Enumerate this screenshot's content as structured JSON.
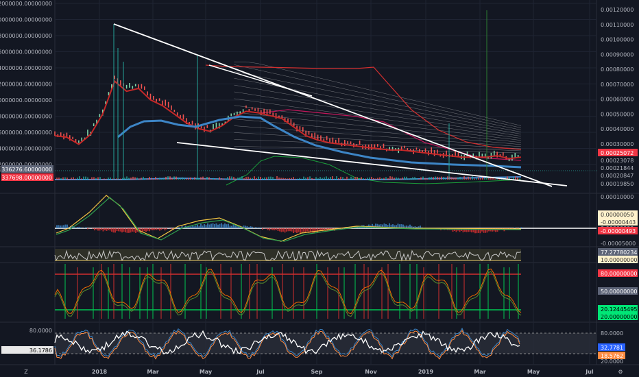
{
  "colors": {
    "background": "#131722",
    "grid": "#1f2433",
    "price_up": "#26a69a",
    "price_down": "#ef5350",
    "trend_line": "#ffffff",
    "red_band": "#c2185b",
    "blue_ma": "#3d85c6",
    "green": "#00c853",
    "label_red": "#f23645",
    "label_grey": "#5d6477",
    "label_yellow": "#fff2cc",
    "label_green": "#00e676",
    "label_blue": "#2962ff",
    "label_orange": "#ff8c42"
  },
  "chart_data": [
    {
      "type": "line",
      "panel": "price",
      "left_axis": {
        "ticks": [
          "22000000.00000000",
          "20000000.00000000",
          "18000000.00000000",
          "16000000.00000000",
          "14000000.00000000",
          "12000000.00000000",
          "10000000.00000000",
          "8000000.00000000",
          "6000000.00000000",
          "4000000.00000000",
          "2000000.00000000"
        ],
        "values": [
          22000000,
          20000000,
          18000000,
          16000000,
          14000000,
          12000000,
          10000000,
          8000000,
          6000000,
          4000000,
          2000000
        ],
        "labels": [
          {
            "text": "1336276.60000000",
            "color": "label_grey"
          },
          {
            "text": "337698.00000000",
            "color": "label_red"
          }
        ]
      },
      "right_axis": {
        "ticks": [
          "0.00120000",
          "0.00110000",
          "0.00100000",
          "0.00090000",
          "0.00080000",
          "0.00070000",
          "0.00060000",
          "0.00050000",
          "0.00040000",
          "0.00030000",
          "0.00025072",
          "0.00023078",
          "0.00021844",
          "0.00020847",
          "0.00019850"
        ],
        "values": [
          0.0012,
          0.0011,
          0.001,
          0.0009,
          0.0008,
          0.0007,
          0.0006,
          0.0005,
          0.0004,
          0.0003
        ],
        "labels": [
          {
            "text": "0.00025072",
            "color": "label_red"
          },
          {
            "text": "0.00023078"
          },
          {
            "text": "0.00021844"
          },
          {
            "text": "0.00020847"
          },
          {
            "text": "0.00019850"
          }
        ]
      },
      "price_series": [
        [
          0,
          0.00037
        ],
        [
          4,
          0.00036
        ],
        [
          8,
          0.00031
        ],
        [
          12,
          0.00038
        ],
        [
          16,
          0.00052
        ],
        [
          20,
          0.00075
        ],
        [
          24,
          0.00068
        ],
        [
          28,
          0.0007
        ],
        [
          32,
          0.00062
        ],
        [
          36,
          0.00058
        ],
        [
          40,
          0.00052
        ],
        [
          44,
          0.00046
        ],
        [
          48,
          0.00042
        ],
        [
          52,
          0.0004
        ],
        [
          56,
          0.00044
        ],
        [
          60,
          0.0005
        ],
        [
          64,
          0.00054
        ],
        [
          68,
          0.00053
        ],
        [
          72,
          0.00051
        ],
        [
          76,
          0.00049
        ],
        [
          80,
          0.00043
        ],
        [
          84,
          0.00037
        ],
        [
          88,
          0.00034
        ],
        [
          92,
          0.00032
        ],
        [
          96,
          0.00031
        ],
        [
          100,
          0.0003
        ],
        [
          104,
          0.00029
        ],
        [
          108,
          0.00028
        ],
        [
          112,
          0.00027
        ],
        [
          116,
          0.00027
        ],
        [
          120,
          0.00026
        ],
        [
          124,
          0.00025
        ],
        [
          128,
          0.00024
        ],
        [
          132,
          0.00023
        ],
        [
          136,
          0.00022
        ],
        [
          140,
          0.00022
        ],
        [
          144,
          0.00022
        ],
        [
          148,
          0.00023
        ],
        [
          152,
          0.00021
        ],
        [
          156,
          0.00022
        ]
      ]
    },
    {
      "type": "line",
      "panel": "macd",
      "right_axis": {
        "ticks": [
          "0.00010000",
          "0.00000000",
          "-0.00005000"
        ],
        "labels": [
          {
            "text": "0.00000050",
            "color": "label_yellow"
          },
          {
            "text": "-0.00000443",
            "color": "label_yellow"
          },
          {
            "text": "-0.00000493",
            "color": "label_red"
          }
        ]
      }
    },
    {
      "type": "line",
      "panel": "ind2",
      "right_axis": {
        "labels": [
          {
            "text": "77.27780234",
            "color": "label_grey"
          },
          {
            "text": "10.00000000",
            "color": "label_yellow"
          }
        ]
      }
    },
    {
      "type": "line",
      "panel": "stoch",
      "right_axis": {
        "labels": [
          {
            "text": "80.00000000",
            "color": "label_red"
          },
          {
            "text": "50.00000000",
            "color": "label_grey"
          },
          {
            "text": "20.12445495",
            "color": "label_green"
          },
          {
            "text": "20.00000000",
            "color": "label_green"
          }
        ]
      }
    },
    {
      "type": "line",
      "panel": "rsi",
      "left_axis": {
        "ticks": [
          "80.0000"
        ],
        "labels": [
          {
            "text": "36.1786"
          }
        ]
      },
      "right_axis": {
        "ticks": [
          "80.0000",
          "20.0000"
        ],
        "labels": [
          {
            "text": "32.7781",
            "color": "label_blue"
          },
          {
            "text": "18.5762",
            "color": "label_orange"
          }
        ]
      }
    }
  ],
  "time_axis": {
    "labels": [
      "2018",
      "Mar",
      "May",
      "Jul",
      "Sep",
      "Nov",
      "2019",
      "Mar",
      "May",
      "Jul"
    ]
  }
}
